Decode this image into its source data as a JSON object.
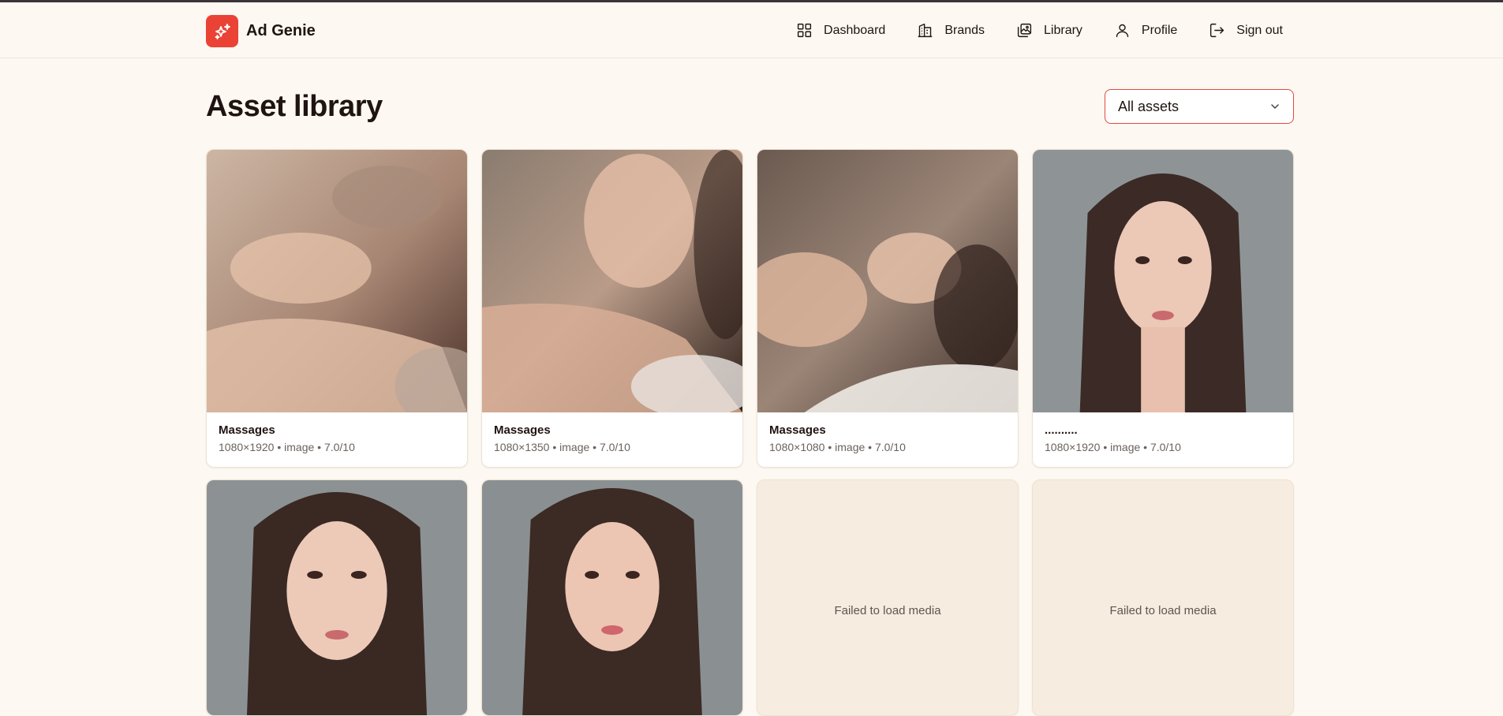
{
  "app": {
    "name": "Ad Genie",
    "accent": "#ea4336"
  },
  "nav": {
    "items": [
      {
        "label": "Dashboard",
        "icon": "grid-icon"
      },
      {
        "label": "Brands",
        "icon": "building-icon"
      },
      {
        "label": "Library",
        "icon": "images-icon"
      },
      {
        "label": "Profile",
        "icon": "user-icon"
      },
      {
        "label": "Sign out",
        "icon": "sign-out-icon"
      }
    ]
  },
  "page": {
    "title": "Asset library"
  },
  "filter": {
    "selected": "All assets"
  },
  "assets": [
    {
      "title": "Massages",
      "meta": "1080×1920 • image • 7.0/10"
    },
    {
      "title": "Massages",
      "meta": "1080×1350 • image • 7.0/10"
    },
    {
      "title": "Massages",
      "meta": "1080×1080 • image • 7.0/10"
    },
    {
      "title": "..........",
      "meta": "1080×1920 • image • 7.0/10"
    }
  ],
  "failed_media_text": "Failed to load media"
}
